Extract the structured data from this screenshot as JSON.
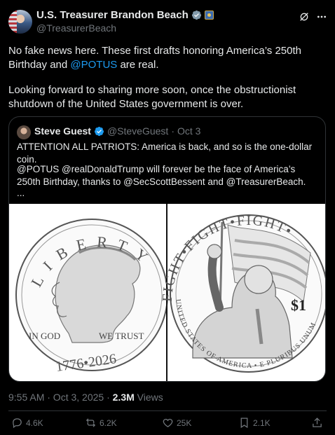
{
  "author": {
    "name": "U.S. Treasurer Brandon Beach",
    "handle": "@TreasurerBeach"
  },
  "post": {
    "line1_before": "No fake news here. These first drafts honoring America’s 250th Birthday and ",
    "line1_mention": "@POTUS",
    "line1_after": " are real.",
    "paragraph2": "Looking forward to sharing more soon, once the obstructionist shutdown of the United States government is over."
  },
  "quote": {
    "name": "Steve Guest",
    "handle": "@SteveGuest",
    "dot": "·",
    "date": "Oct 3",
    "text1": "ATTENTION ALL PATRIOTS: America is back, and so is the one-dollar coin.",
    "text2": "@POTUS @realDonaldTrump will forever be the face of America’s 250th Birthday, thanks to @SecScottBessent and @TreasurerBeach.",
    "text3": "..."
  },
  "coin_front": {
    "arc_text": "LIBERTY",
    "left_text": "IN GOD",
    "right_text": "WE TRUST",
    "years": "1776•2026"
  },
  "coin_back": {
    "arc_text": "FIGHT•FIGHT•FIGHT•",
    "bottom_text": "UNITED STATES OF AMERICA • E PLURIBUS UNUM",
    "denomination": "$1"
  },
  "meta": {
    "time": "9:55 AM · Oct 3, 2025 · ",
    "views_count": "2.3M",
    "views_label": " Views"
  },
  "actions": {
    "replies": "4.6K",
    "reposts": "6.2K",
    "likes": "25K",
    "bookmarks": "2.1K"
  },
  "colors": {
    "background": "#000000",
    "accent": "#1d9bf0",
    "muted": "#71767b"
  }
}
